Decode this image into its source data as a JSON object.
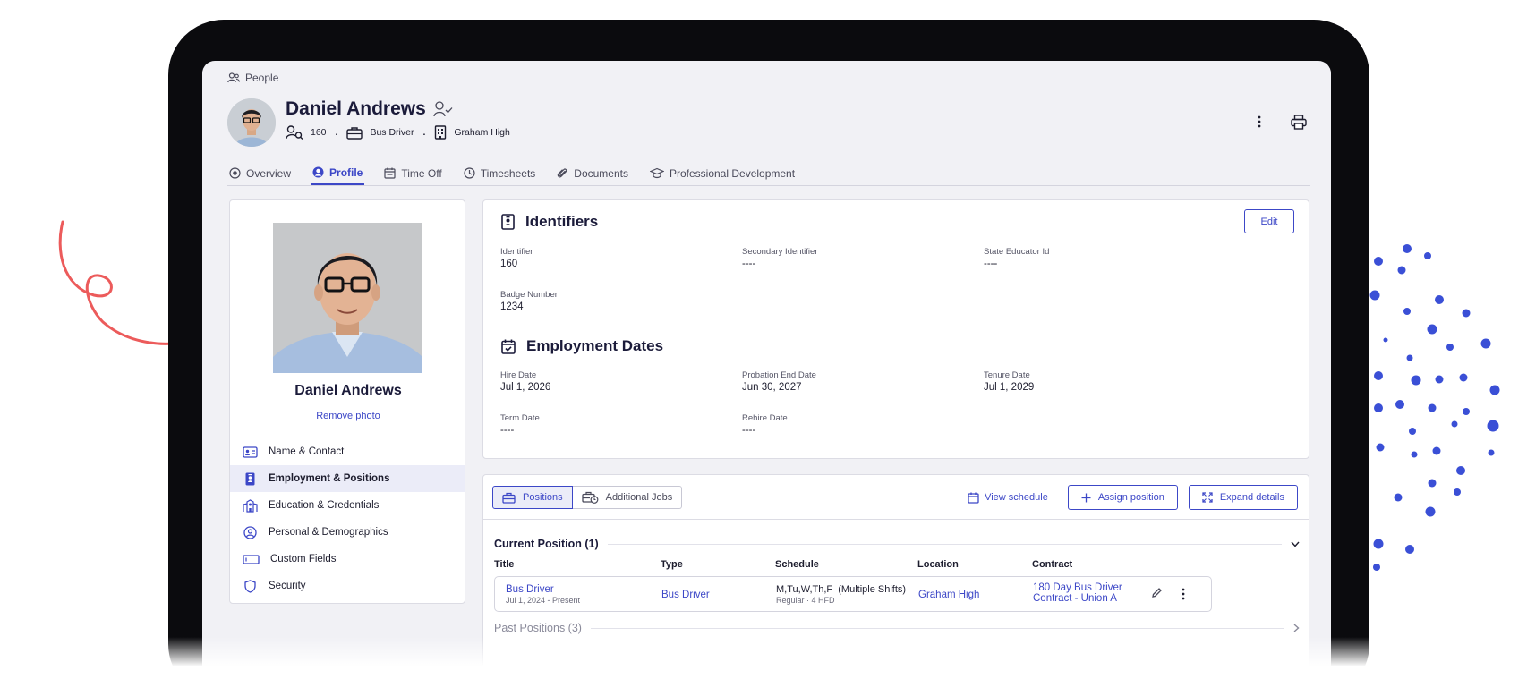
{
  "breadcrumb": {
    "label": "People"
  },
  "header": {
    "name": "Daniel Andrews",
    "employee_number": "160",
    "position": "Bus Driver",
    "location": "Graham High"
  },
  "tabs": [
    {
      "label": "Overview",
      "icon": "target-icon"
    },
    {
      "label": "Profile",
      "icon": "user-circle-icon",
      "active": true
    },
    {
      "label": "Time Off",
      "icon": "calendar-icon"
    },
    {
      "label": "Timesheets",
      "icon": "clock-icon"
    },
    {
      "label": "Documents",
      "icon": "paperclip-icon"
    },
    {
      "label": "Professional Development",
      "icon": "graduation-cap-icon"
    }
  ],
  "profile_card": {
    "name": "Daniel Andrews",
    "remove_photo": "Remove photo",
    "nav": [
      {
        "label": "Name & Contact",
        "icon": "id-card-icon"
      },
      {
        "label": "Employment & Positions",
        "icon": "badge-icon",
        "active": true
      },
      {
        "label": "Education & Credentials",
        "icon": "school-icon"
      },
      {
        "label": "Personal & Demographics",
        "icon": "person-circle-icon"
      },
      {
        "label": "Custom Fields",
        "icon": "input-field-icon"
      },
      {
        "label": "Security",
        "icon": "shield-icon"
      }
    ]
  },
  "identifiers": {
    "title": "Identifiers",
    "edit_label": "Edit",
    "fields": [
      {
        "label": "Identifier",
        "value": "160"
      },
      {
        "label": "Secondary Identifier",
        "value": "----"
      },
      {
        "label": "State Educator Id",
        "value": "----"
      },
      {
        "label": "Badge Number",
        "value": "1234"
      }
    ]
  },
  "employment_dates": {
    "title": "Employment Dates",
    "fields": [
      {
        "label": "Hire Date",
        "value": "Jul 1, 2026"
      },
      {
        "label": "Probation End Date",
        "value": "Jun 30, 2027"
      },
      {
        "label": "Tenure Date",
        "value": "Jul 1, 2029"
      },
      {
        "label": "Term Date",
        "value": "----"
      },
      {
        "label": "Rehire Date",
        "value": "----"
      }
    ]
  },
  "positions": {
    "tab_positions": "Positions",
    "tab_additional": "Additional Jobs",
    "view_schedule": "View schedule",
    "assign_position": "Assign position",
    "expand_details": "Expand details",
    "current_heading": "Current Position (1)",
    "columns": [
      "Title",
      "Type",
      "Schedule",
      "Location",
      "Contract"
    ],
    "current_row": {
      "title": "Bus Driver",
      "dates": "Jul 1, 2024 - Present",
      "type": "Bus Driver",
      "schedule": "M,Tu,W,Th,F  (Multiple Shifts)",
      "schedule_sub": "Regular · 4 HFD",
      "location": "Graham High",
      "contract_line1": "180 Day Bus Driver",
      "contract_line2": "Contract - Union A"
    },
    "past_heading": "Past Positions (3)"
  },
  "colors": {
    "accent": "#3c47c7",
    "decor_red": "#ec5b5b",
    "decor_blue": "#3a4fd6"
  }
}
